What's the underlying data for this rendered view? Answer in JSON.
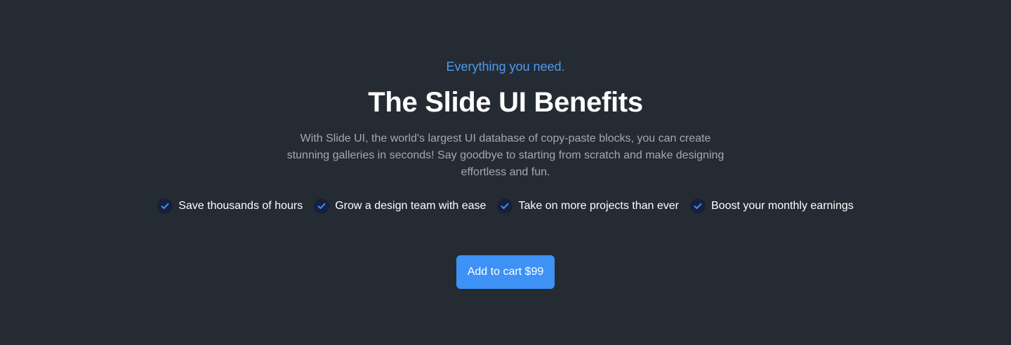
{
  "hero": {
    "eyebrow": "Everything you need.",
    "title": "The Slide UI Benefits",
    "description": "With Slide UI, the world's largest UI database of copy-paste blocks, you can create stunning galleries in seconds! Say goodbye to starting from scratch and make designing effortless and fun."
  },
  "benefits": {
    "icon": "check-icon",
    "items": [
      "Save thousands of hours",
      "Grow a design team with ease",
      "Take on more projects than ever",
      "Boost your monthly earnings"
    ]
  },
  "cta": {
    "label": "Add to cart $99"
  },
  "colors": {
    "background": "#252b33",
    "accent": "#3e91f5",
    "eyebrow": "#4b9bf0",
    "heading": "#ffffff",
    "body_text": "#a3a9b3",
    "check_circle": "#16203a",
    "check_mark": "#3e91f5"
  }
}
